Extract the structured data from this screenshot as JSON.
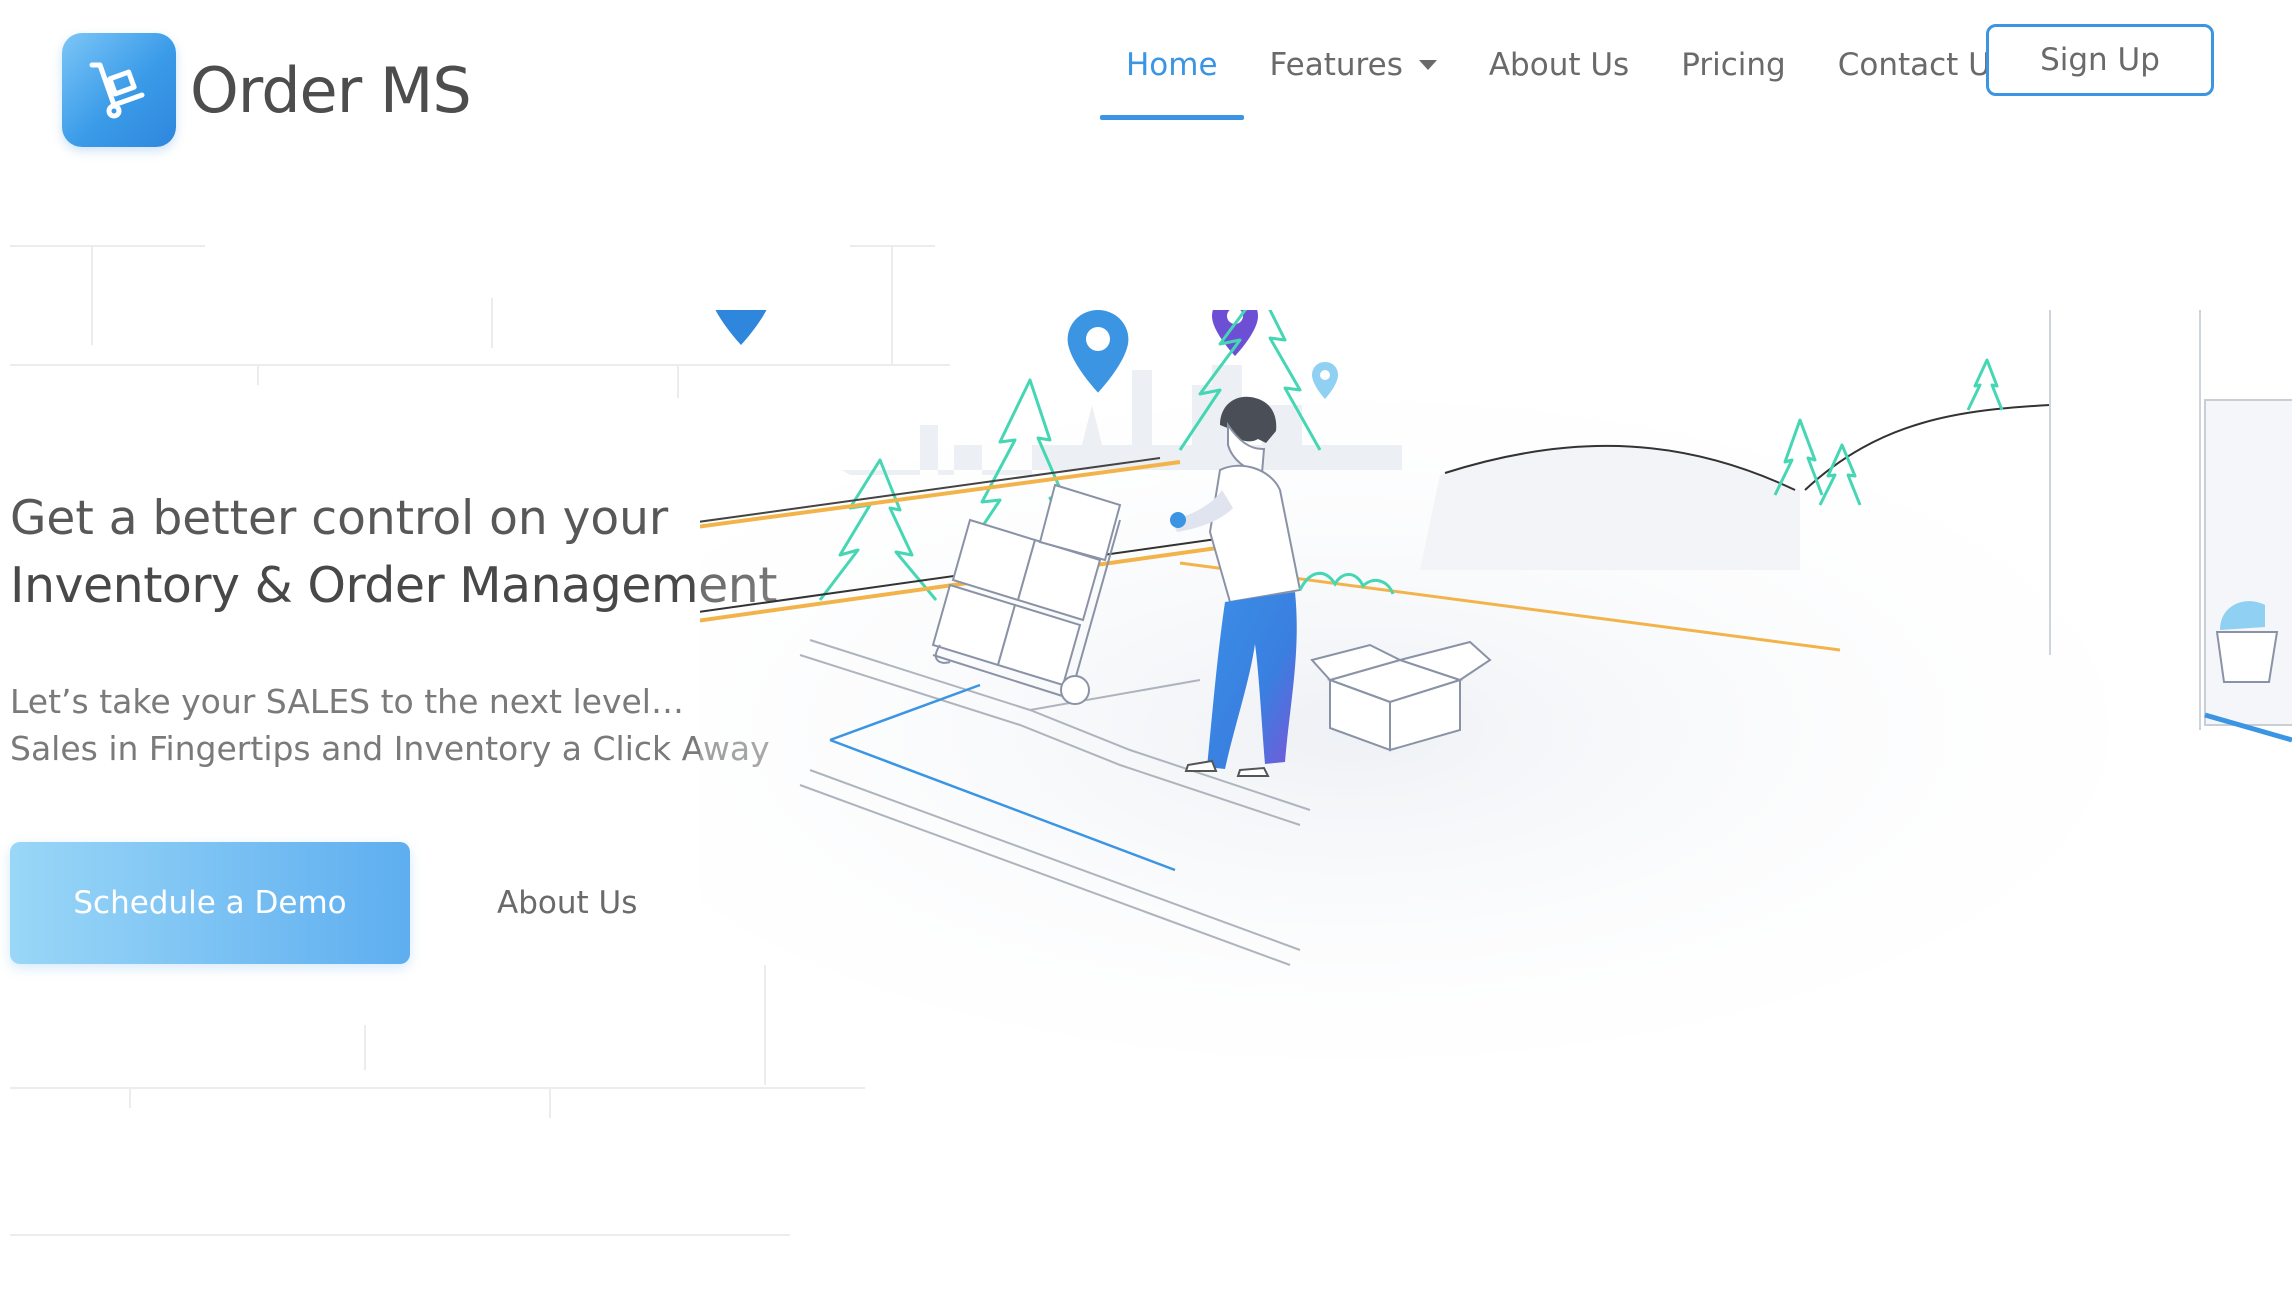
{
  "brand": {
    "name": "Order MS",
    "logo_icon": "hand-truck-icon",
    "accent": "#3b95e3"
  },
  "nav": {
    "items": [
      {
        "label": "Home",
        "active": true
      },
      {
        "label": "Features",
        "active": false,
        "has_dropdown": true
      },
      {
        "label": "About Us",
        "active": false
      },
      {
        "label": "Pricing",
        "active": false
      },
      {
        "label": "Contact Us",
        "active": false
      }
    ],
    "signup_label": "Sign Up"
  },
  "hero": {
    "headline_line1": "Get a better control on your",
    "headline_line2": "Inventory & Order Management",
    "sub_line1": "Let’s take your SALES to the next level…",
    "sub_line2": "Sales in Fingertips and Inventory a Click Away",
    "demo_button": "Schedule a Demo",
    "about_link": "About Us"
  },
  "colors": {
    "button_gradient_start": "#9ad7f7",
    "button_gradient_end": "#5eaef0",
    "road_stripe": "#f2b44a",
    "tree": "#45d6b4"
  }
}
